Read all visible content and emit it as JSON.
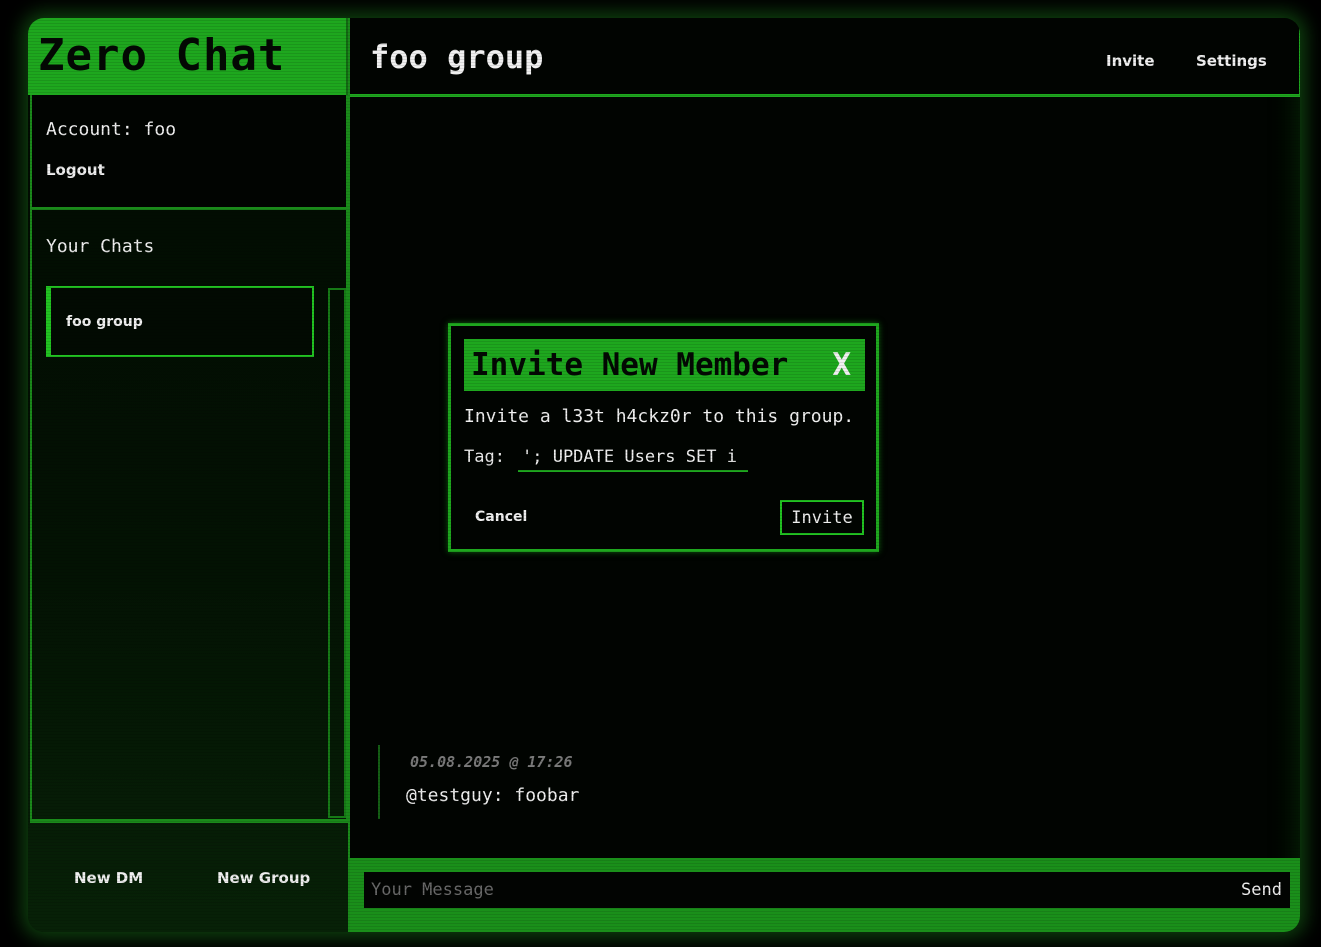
{
  "app": {
    "title": "Zero Chat"
  },
  "account": {
    "label": "Account: foo",
    "logout_label": "Logout"
  },
  "sidebar": {
    "chats_title": "Your Chats",
    "chats": [
      {
        "label": "foo group"
      }
    ],
    "new_dm_label": "New DM",
    "new_group_label": "New Group"
  },
  "header": {
    "chat_title": "foo group",
    "invite_label": "Invite",
    "settings_label": "Settings"
  },
  "messages": [
    {
      "timestamp": "05.08.2025 @ 17:26",
      "text": "@testguy: foobar"
    }
  ],
  "composer": {
    "placeholder": "Your Message",
    "send_label": "Send"
  },
  "modal": {
    "title": "Invite New Member",
    "close_label": "X",
    "description": "Invite a l33t h4ckz0r to this group.",
    "tag_label": "Tag:",
    "tag_value": "'; UPDATE Users SET i",
    "cancel_label": "Cancel",
    "invite_label": "Invite"
  },
  "colors": {
    "accent": "#1ea71e",
    "background": "#010401",
    "text": "#f0f0f0"
  }
}
